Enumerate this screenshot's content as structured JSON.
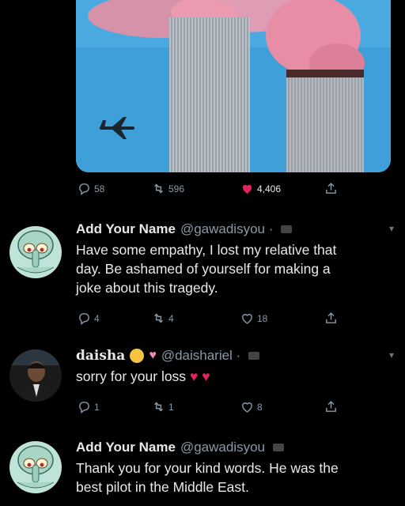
{
  "top_actions": {
    "replies": "58",
    "retweets": "596",
    "likes": "4,406"
  },
  "tweets": [
    {
      "name": "Add Your Name",
      "handle": "@gawadisyou ·",
      "text_lines": [
        "Have some empathy, I lost my relative that",
        "day.  Be ashamed of yourself for making a",
        "joke about this tragedy."
      ],
      "replies": "4",
      "retweets": "4",
      "likes": "18"
    },
    {
      "name": "daisha",
      "handle": "@daishariel ·",
      "text": "sorry for your loss",
      "replies": "1",
      "retweets": "1",
      "likes": "8"
    },
    {
      "name": "Add Your Name",
      "handle": "@gawadisyou",
      "text_lines": [
        "Thank you for your kind words. He was the",
        "best pilot in the Middle East."
      ]
    }
  ],
  "colors": {
    "background": "#000000",
    "text": "#e7e9ea",
    "muted": "#8b98a5",
    "like_red": "#e0245e"
  },
  "icons": [
    "reply-icon",
    "retweet-icon",
    "heart-icon",
    "share-icon",
    "chevron-down-icon",
    "broken-heart-icon",
    "smiling-face-icon",
    "sparkling-heart-icon"
  ]
}
